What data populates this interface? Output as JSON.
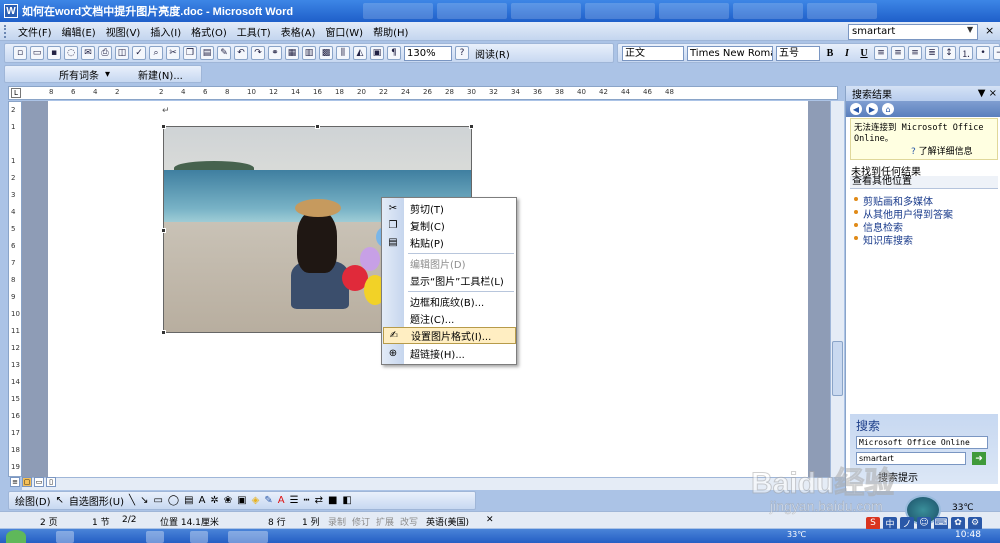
{
  "window": {
    "title": "如何在word文档中提升图片亮度.doc - Microsoft Word",
    "app_icon": "W"
  },
  "menu": {
    "items": [
      "文件(F)",
      "编辑(E)",
      "视图(V)",
      "插入(I)",
      "格式(O)",
      "工具(T)",
      "表格(A)",
      "窗口(W)",
      "帮助(H)"
    ],
    "help_search_value": "smartart",
    "close_glyph": "×"
  },
  "standard_toolbar": {
    "zoom": "130%",
    "read_label": "阅读(R)"
  },
  "format_toolbar": {
    "style": "正文",
    "font": "Times New Roman",
    "size": "五号",
    "bold": "B",
    "italic": "I",
    "underline": "U"
  },
  "toolbar2": {
    "words_label": "所有词条",
    "new_label": "新建(N)..."
  },
  "ruler": {
    "tab_symbol": "L",
    "numbers": [
      "8",
      "6",
      "4",
      "2",
      "",
      "2",
      "4",
      "6",
      "8",
      "10",
      "12",
      "14",
      "16",
      "18",
      "20",
      "22",
      "24",
      "26",
      "28",
      "30",
      "32",
      "34",
      "36",
      "38",
      "40",
      "42",
      "44",
      "46",
      "48"
    ],
    "vnumbers": [
      "2",
      "1",
      "",
      "1",
      "2",
      "3",
      "4",
      "5",
      "6",
      "7",
      "8",
      "9",
      "10",
      "11",
      "12",
      "13",
      "14",
      "15",
      "16",
      "17",
      "18",
      "19"
    ]
  },
  "document": {
    "paragraph_mark": "↵"
  },
  "context_menu": {
    "items": [
      {
        "label": "剪切(T)",
        "icon": "scissors-icon",
        "disabled": false
      },
      {
        "label": "复制(C)",
        "icon": "copy-icon",
        "disabled": false
      },
      {
        "label": "粘贴(P)",
        "icon": "paste-icon",
        "disabled": false
      },
      {
        "label": "编辑图片(D)",
        "icon": "",
        "disabled": true
      },
      {
        "label": "显示“图片”工具栏(L)",
        "icon": "",
        "disabled": false
      },
      {
        "label": "边框和底纹(B)...",
        "icon": "",
        "disabled": false
      },
      {
        "label": "题注(C)...",
        "icon": "",
        "disabled": false
      },
      {
        "label": "设置图片格式(I)...",
        "icon": "format-picture-icon",
        "disabled": false,
        "highlighted": true
      },
      {
        "label": "超链接(H)...",
        "icon": "hyperlink-icon",
        "disabled": false
      }
    ]
  },
  "task_pane": {
    "title": "搜索结果",
    "close_glyph": "▼ ×",
    "message": "无法连接到 Microsoft Office Online。",
    "more_info": "了解详细信息",
    "no_results": "未找到任何结果",
    "other_locations": "查看其他位置",
    "links": [
      "剪贴画和多媒体",
      "从其他用户得到答案",
      "信息检索",
      "知识库搜索"
    ],
    "search_label": "搜索",
    "search_source": "Microsoft Office Online",
    "search_value": "smartart",
    "search_tip_label": "搜索提示"
  },
  "draw_toolbar": {
    "draw_label": "绘图(D)",
    "autoshape_label": "自选图形(U)"
  },
  "status_bar": {
    "page": "2 页",
    "section": "1 节",
    "page_of": "2/2",
    "position": "位置 14.1厘米",
    "line": "8 行",
    "column": "1 列",
    "rec": "录制",
    "trk": "修订",
    "ext": "扩展",
    "ovr": "改写",
    "lang": "英语(美国)"
  },
  "weather": {
    "temp": "33℃"
  },
  "taskbar": {
    "temp": "33℃",
    "clock": "10:48"
  },
  "ime": {
    "items": [
      "S",
      "中",
      "ノ",
      "☺",
      "⌨",
      "✿",
      "⚙"
    ]
  },
  "watermark": {
    "logo": "Baidu经验",
    "url": "jingyan.baidu.com"
  },
  "colors": {
    "title_bar": "#1f5fc9",
    "toolbar_bg": "#c7d8f1",
    "menu_highlight": "#ffeec2",
    "task_pane_nav": "#5b7fbd",
    "link_color": "#1b3c8c"
  }
}
